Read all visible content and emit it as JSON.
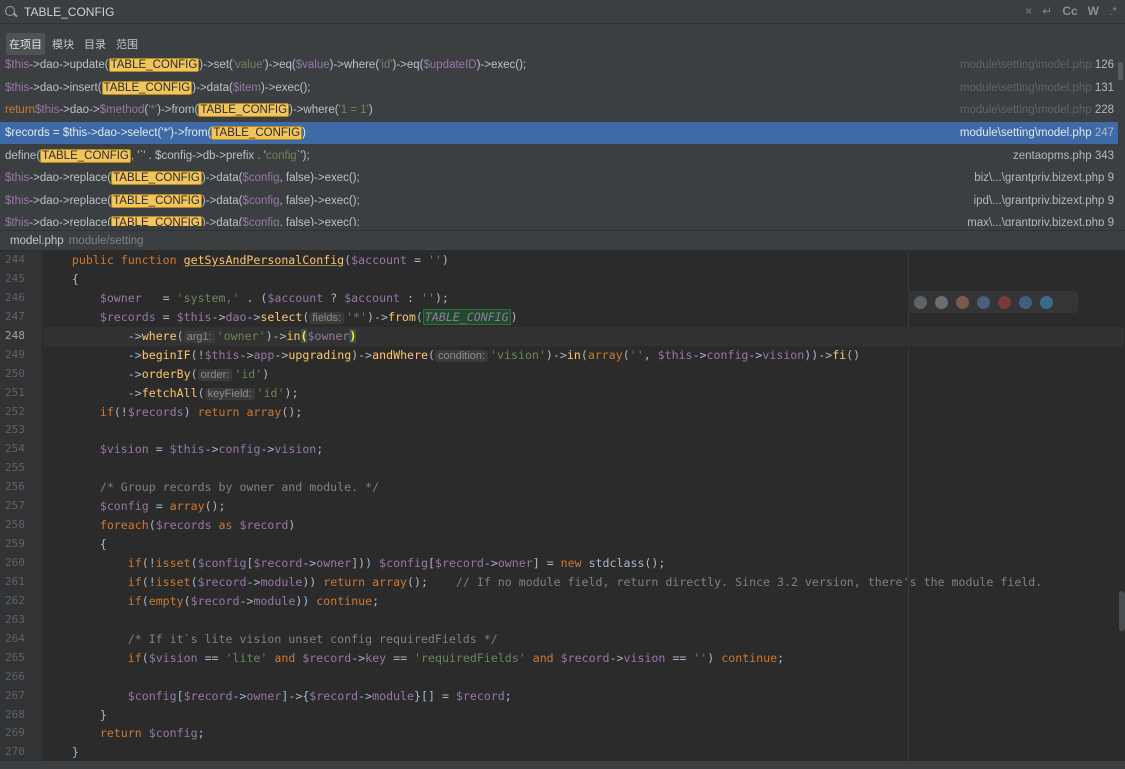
{
  "search": {
    "query": "TABLE_CONFIG",
    "tools": [
      "×",
      "↵",
      "Cc",
      "W",
      ".*"
    ]
  },
  "scope_tabs": [
    "在项目",
    "模块",
    "目录",
    "范围"
  ],
  "results": [
    {
      "parts": [
        [
          "var",
          "$this"
        ],
        [
          "code",
          "->dao->update("
        ],
        [
          "hl",
          "TABLE_CONFIG"
        ],
        [
          "code",
          ")->set("
        ],
        [
          "str",
          "'value'"
        ],
        [
          "code",
          ")->eq("
        ],
        [
          "var",
          "$value"
        ],
        [
          "code",
          ")->where("
        ],
        [
          "str",
          "'id'"
        ],
        [
          "code",
          ")->eq("
        ],
        [
          "var",
          "$updateID"
        ],
        [
          "code",
          ")->exec();"
        ]
      ],
      "loc": "module\\setting\\model.php",
      "line": "126"
    },
    {
      "parts": [
        [
          "var",
          "$this"
        ],
        [
          "code",
          "->dao->insert("
        ],
        [
          "hl",
          "TABLE_CONFIG"
        ],
        [
          "code",
          ")->data("
        ],
        [
          "var",
          "$item"
        ],
        [
          "code",
          ")->exec();"
        ]
      ],
      "loc": "module\\setting\\model.php",
      "line": "131"
    },
    {
      "parts": [
        [
          "kw",
          "return "
        ],
        [
          "var",
          "$this"
        ],
        [
          "code",
          "->dao->"
        ],
        [
          "var",
          "$method"
        ],
        [
          "code",
          "("
        ],
        [
          "str",
          "'*'"
        ],
        [
          "code",
          ")->from("
        ],
        [
          "hl",
          "TABLE_CONFIG"
        ],
        [
          "code",
          ")->where("
        ],
        [
          "str",
          "'1 = 1'"
        ],
        [
          "code",
          ")"
        ]
      ],
      "loc": "module\\setting\\model.php",
      "line": "228"
    },
    {
      "parts": [
        [
          "code",
          "$records = $this->dao->select('*')->from("
        ],
        [
          "hl",
          "TABLE_CONFIG"
        ],
        [
          "code",
          ")"
        ]
      ],
      "loc": "module\\setting\\model.php",
      "line": "247",
      "selected": true
    },
    {
      "parts": [
        [
          "code",
          "define("
        ],
        [
          "hl",
          "TABLE_CONFIG"
        ],
        [
          "code",
          ",        '`' . $config->db->prefix . '"
        ],
        [
          "str",
          "config"
        ],
        [
          "code",
          "`');"
        ]
      ],
      "loc": "zentaopms.php",
      "line": "343",
      "bright": true
    },
    {
      "parts": [
        [
          "var",
          "$this"
        ],
        [
          "code",
          "->dao->replace("
        ],
        [
          "hl",
          "TABLE_CONFIG"
        ],
        [
          "code",
          ")->data("
        ],
        [
          "var",
          "$config"
        ],
        [
          "code",
          ", false)->exec();"
        ]
      ],
      "loc": "biz\\...\\grantpriv.bizext.php",
      "line": "9",
      "bright": true
    },
    {
      "parts": [
        [
          "var",
          "$this"
        ],
        [
          "code",
          "->dao->replace("
        ],
        [
          "hl",
          "TABLE_CONFIG"
        ],
        [
          "code",
          ")->data("
        ],
        [
          "var",
          "$config"
        ],
        [
          "code",
          ", false)->exec();"
        ]
      ],
      "loc": "ipd\\...\\grantpriv.bizext.php",
      "line": "9",
      "bright": true
    },
    {
      "parts": [
        [
          "var",
          "$this"
        ],
        [
          "code",
          "->dao->replace("
        ],
        [
          "hl",
          "TABLE_CONFIG"
        ],
        [
          "code",
          ")->data("
        ],
        [
          "var",
          "$config"
        ],
        [
          "code",
          ", false)->exec();"
        ]
      ],
      "loc": "max\\...\\grantpriv.bizext.php",
      "line": "9",
      "bright": true
    }
  ],
  "file_header": {
    "name": "model.php",
    "path": "module/setting"
  },
  "editor": {
    "current_line": "248",
    "lines": [
      {
        "n": "244",
        "html": "    <span class=\"k\">public function </span><span class=\"fn-decl\">getSysAndPersonalConfig</span>(<span class=\"v\">$account</span> = <span class=\"s\">''</span>)"
      },
      {
        "n": "245",
        "html": "    {"
      },
      {
        "n": "246",
        "html": "        <span class=\"v\">$owner</span>   = <span class=\"s\">'system,'</span> . (<span class=\"v\">$account</span> ? <span class=\"v\">$account</span> : <span class=\"s\">''</span>);"
      },
      {
        "n": "247",
        "html": "        <span class=\"v\">$records</span> = <span class=\"v\">$this</span>-><span class=\"v\">dao</span>-><span class=\"f\">select</span>(<span class=\"hint\">fields:</span><span class=\"s\">'*'</span>)-><span class=\"f\">from</span>(<span class=\"const\">TABLE_CONFIG</span>)"
      },
      {
        "n": "248",
        "html": "            -><span class=\"f\">where</span>(<span class=\"hint\">arg1:</span><span class=\"s\">'owner'</span>)-><span class=\"f\">in</span><span class=\"paren-match\">(</span><span class=\"v\">$owner</span><span class=\"paren-match\">)</span>"
      },
      {
        "n": "249",
        "html": "            -><span class=\"f\">beginIF</span>(!<span class=\"v\">$this</span>-><span class=\"v\">app</span>-><span class=\"f\">upgrading</span>)-><span class=\"f\">andWhere</span>(<span class=\"hint\">condition:</span><span class=\"s\">'vision'</span>)-><span class=\"f\">in</span>(<span class=\"k\">array</span>(<span class=\"s\">''</span>, <span class=\"v\">$this</span>-><span class=\"v\">config</span>-><span class=\"v\">vision</span>))-><span class=\"f\">fi</span>()"
      },
      {
        "n": "250",
        "html": "            -><span class=\"f\">orderBy</span>(<span class=\"hint\">order:</span><span class=\"s\">'id'</span>)"
      },
      {
        "n": "251",
        "html": "            -><span class=\"f\">fetchAll</span>(<span class=\"hint\">keyField:</span><span class=\"s\">'id'</span>);"
      },
      {
        "n": "252",
        "html": "        <span class=\"k\">if</span>(!<span class=\"v\">$records</span>) <span class=\"k\">return array</span>();"
      },
      {
        "n": "253",
        "html": ""
      },
      {
        "n": "254",
        "html": "        <span class=\"v\">$vision</span> = <span class=\"v\">$this</span>-><span class=\"v\">config</span>-><span class=\"v\">vision</span>;"
      },
      {
        "n": "255",
        "html": ""
      },
      {
        "n": "256",
        "html": "        <span class=\"c\">/* Group records by owner and module. */</span>"
      },
      {
        "n": "257",
        "html": "        <span class=\"v\">$config</span> = <span class=\"k\">array</span>();"
      },
      {
        "n": "258",
        "html": "        <span class=\"k\">foreach</span>(<span class=\"v\">$records</span> <span class=\"k\">as</span> <span class=\"v\">$record</span>)"
      },
      {
        "n": "259",
        "html": "        {"
      },
      {
        "n": "260",
        "html": "            <span class=\"k\">if</span>(!<span class=\"k\">isset</span>(<span class=\"v\">$config</span>[<span class=\"v\">$record</span>-><span class=\"v\">owner</span>])) <span class=\"v\">$config</span>[<span class=\"v\">$record</span>-><span class=\"v\">owner</span>] = <span class=\"k\">new </span>stdclass();"
      },
      {
        "n": "261",
        "html": "            <span class=\"k\">if</span>(!<span class=\"k\">isset</span>(<span class=\"v\">$record</span>-><span class=\"v\">module</span>)) <span class=\"k\">return array</span>();    <span class=\"c\">// If no module field, return directly. Since 3.2 version, there's the module field.</span>"
      },
      {
        "n": "262",
        "html": "            <span class=\"k\">if</span>(<span class=\"k\">empty</span>(<span class=\"v\">$record</span>-><span class=\"v\">module</span>)) <span class=\"k\">continue</span>;"
      },
      {
        "n": "263",
        "html": ""
      },
      {
        "n": "264",
        "html": "            <span class=\"c\">/* If it`s lite vision unset config requiredFields */</span>"
      },
      {
        "n": "265",
        "html": "            <span class=\"k\">if</span>(<span class=\"v\">$vision</span> == <span class=\"s\">'lite'</span> <span class=\"k\">and</span> <span class=\"v\">$record</span>-><span class=\"v\">key</span> == <span class=\"s\">'requiredFields'</span> <span class=\"k\">and</span> <span class=\"v\">$record</span>-><span class=\"v\">vision</span> == <span class=\"s\">''</span>) <span class=\"k\">continue</span>;"
      },
      {
        "n": "266",
        "html": ""
      },
      {
        "n": "267",
        "html": "            <span class=\"v\">$config</span>[<span class=\"v\">$record</span>-><span class=\"v\">owner</span>]->{<span class=\"v\">$record</span>-><span class=\"v\">module</span>}[] = <span class=\"v\">$record</span>;"
      },
      {
        "n": "268",
        "html": "        }"
      },
      {
        "n": "269",
        "html": "        <span class=\"k\">return </span><span class=\"v\">$config</span>;"
      },
      {
        "n": "270",
        "html": "    }"
      }
    ]
  },
  "browser_icons": [
    {
      "name": "structure-icon",
      "color": "#5e6366"
    },
    {
      "name": "chrome-icon",
      "color": "#6a6e71"
    },
    {
      "name": "firefox-icon",
      "color": "#7a5a4a"
    },
    {
      "name": "safari-icon",
      "color": "#4a5f7a"
    },
    {
      "name": "opera-icon",
      "color": "#7a3a3a"
    },
    {
      "name": "ie-icon",
      "color": "#3f5f7f"
    },
    {
      "name": "edge-icon",
      "color": "#3a6a8a"
    }
  ]
}
